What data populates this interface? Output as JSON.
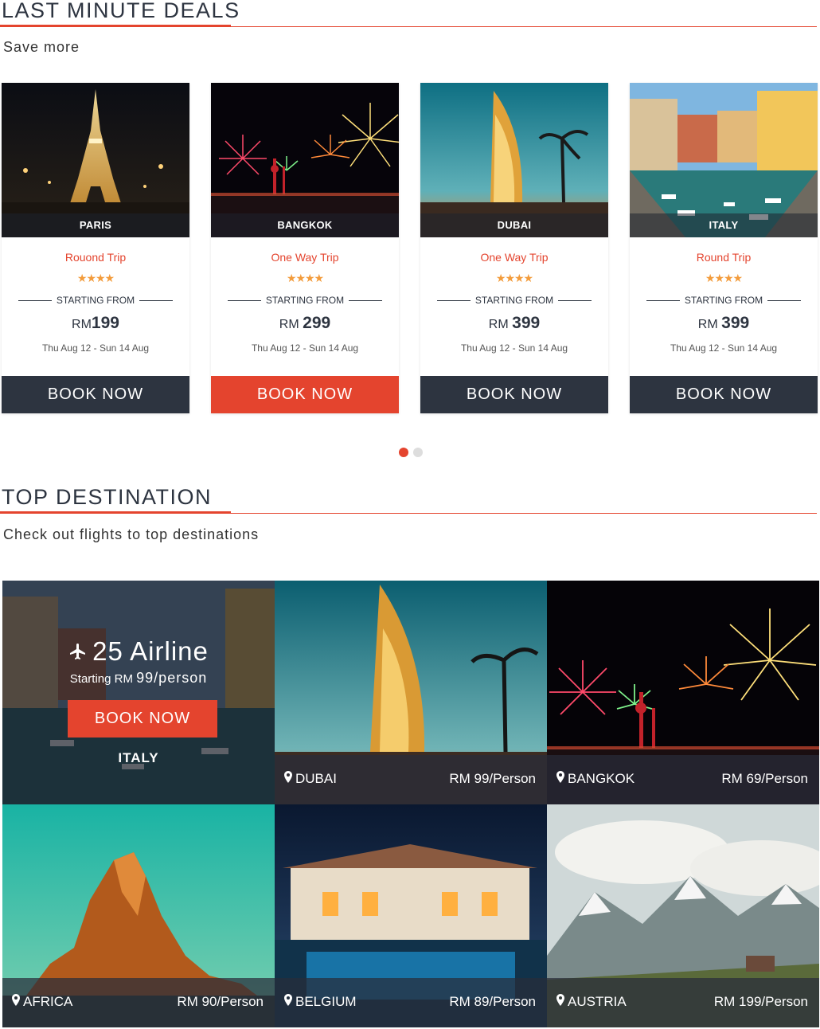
{
  "deals": {
    "title": "LAST MINUTE DEALS",
    "subtitle": "Save more",
    "starting_label": "STARTING FROM",
    "currency": "RM",
    "book_label": "BOOK NOW",
    "cards": [
      {
        "city": "PARIS",
        "trip": "Rouond Trip",
        "price": "199",
        "dates": "Thu Aug 12 - Sun 14 Aug",
        "stars": "★★★★"
      },
      {
        "city": "BANGKOK",
        "trip": "One Way Trip",
        "price": "299",
        "dates": "Thu Aug 12 - Sun 14 Aug",
        "stars": "★★★★"
      },
      {
        "city": "DUBAI",
        "trip": "One Way Trip",
        "price": "399",
        "dates": "Thu Aug 12 - Sun 14 Aug",
        "stars": "★★★★"
      },
      {
        "city": "ITALY",
        "trip": "Round Trip",
        "price": "399",
        "dates": "Thu Aug 12 - Sun 14 Aug",
        "stars": "★★★★"
      }
    ]
  },
  "destinations": {
    "title": "TOP DESTINATION",
    "subtitle": "Check out flights to top destinations",
    "featured": {
      "title": "25 Airline",
      "starting": "Starting RM",
      "price": "99/person",
      "button": "BOOK NOW",
      "place": "ITALY"
    },
    "tiles": [
      {
        "name": "DUBAI",
        "price": "RM 99/Person"
      },
      {
        "name": "BANGKOK",
        "price": "RM 69/Person"
      },
      {
        "name": "AFRICA",
        "price": "RM 90/Person"
      },
      {
        "name": "BELGIUM",
        "price": "RM 89/Person"
      },
      {
        "name": "AUSTRIA",
        "price": "RM 199/Person"
      }
    ]
  },
  "colors": {
    "accent": "#e4442e",
    "dark": "#2d3440",
    "star": "#f39c3c"
  }
}
